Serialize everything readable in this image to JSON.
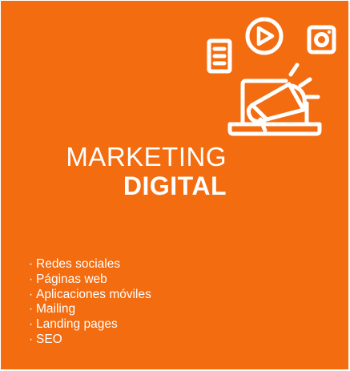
{
  "heading": {
    "line1": "MARKETING",
    "line2": "DIGITAL"
  },
  "services": [
    {
      "bullet": "·",
      "label": "Redes sociales"
    },
    {
      "bullet": "·",
      "label": "Páginas web"
    },
    {
      "bullet": "·",
      "label": "Aplicaciones móviles"
    },
    {
      "bullet": "·",
      "label": "Mailing"
    },
    {
      "bullet": "·",
      "label": "Landing pages"
    },
    {
      "bullet": "·",
      "label": "SEO"
    }
  ],
  "icons": [
    "document-icon",
    "play-button-icon",
    "camera-icon",
    "laptop-icon",
    "megaphone-icon"
  ],
  "colors": {
    "background": "#f36c10",
    "foreground": "#ffffff"
  }
}
